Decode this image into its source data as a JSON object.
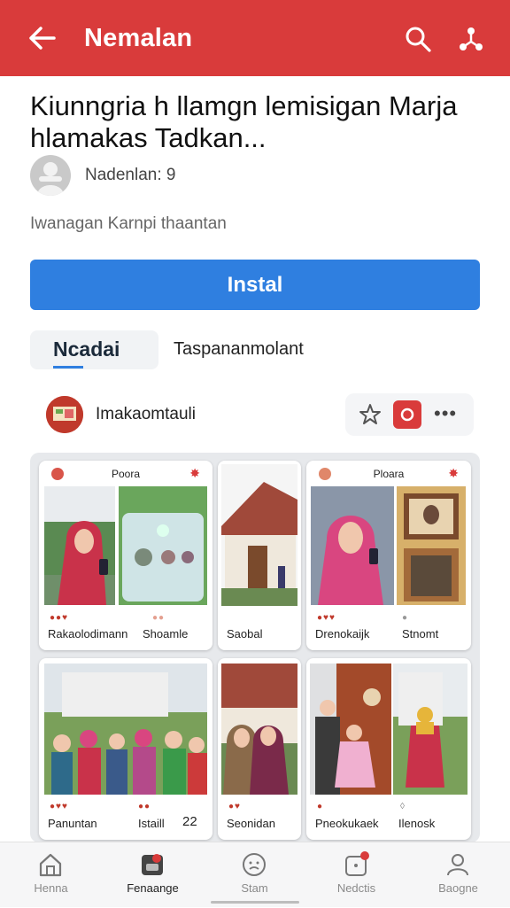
{
  "appbar": {
    "title": "Nemalan",
    "color": "#d93b3b"
  },
  "headline": "Kiunngria h llamgn lemisigan Marja hlamakas Tadkan...",
  "author": {
    "name": "Nadenlan: 9"
  },
  "subtitle": "Iwanagan Karnpi thaantan",
  "install_label": "Instal",
  "tabs": [
    {
      "label": "Ncadai",
      "active": true
    },
    {
      "label": "Taspananmolant"
    }
  ],
  "post": {
    "name": "Imakaomtauli"
  },
  "cards": {
    "c1": {
      "header": "Poora",
      "caption": "Rakaolodimann",
      "caption2": "Shoamle"
    },
    "c2": {
      "caption": "Saobal"
    },
    "c3": {
      "header": "Ploara",
      "caption": "Drenokaijk",
      "caption2": "Stnomt"
    },
    "c4": {
      "caption": "Panuntan",
      "caption2": "Istaill",
      "count": "22"
    },
    "c5": {
      "caption": "Seonidan"
    },
    "c6": {
      "caption": "Pneokukaek",
      "caption2": "Ilenosk"
    }
  },
  "nav": [
    {
      "label": "Henna",
      "icon": "home-icon"
    },
    {
      "label": "Fenaange",
      "icon": "feed-icon",
      "active": true
    },
    {
      "label": "Stam",
      "icon": "face-icon"
    },
    {
      "label": "Nedctis",
      "icon": "notification-icon"
    },
    {
      "label": "Baogne",
      "icon": "profile-icon"
    }
  ]
}
